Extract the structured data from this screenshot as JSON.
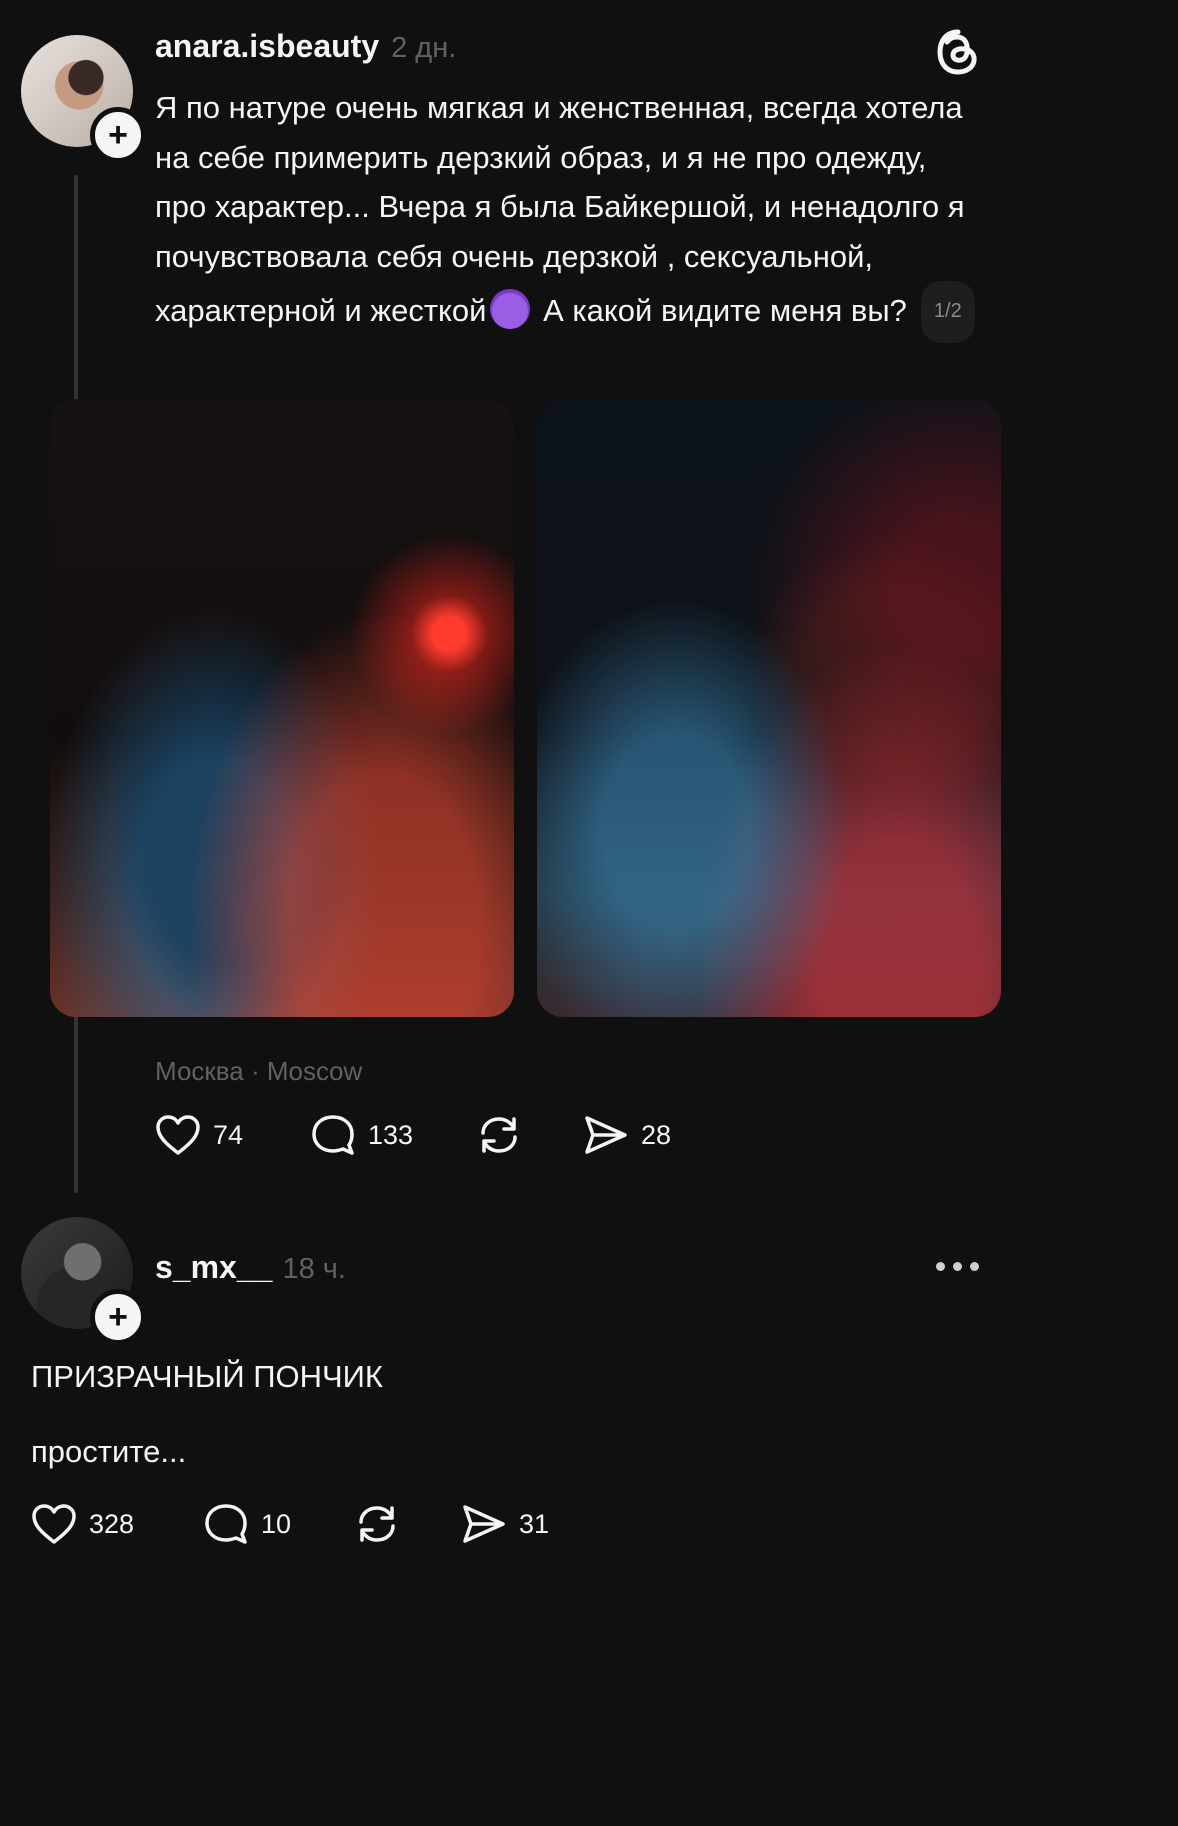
{
  "post": {
    "username": "anara.isbeauty",
    "time": "2 дн.",
    "text_before_emoji": "Я по натуре очень мягкая и женственная, всегда хотела на себе примерить дерзкий образ, и я не про одежду, про характер... Вчера я была Байкершой, и ненадолго я почувствовала себя очень дерзкой , сексуальной, характерной и жесткой",
    "text_after_emoji": " А какой видите меня вы?",
    "emoji": "smiling-devil-emoji",
    "page_indicator": "1/2",
    "location": "Москва · Moscow",
    "actions": {
      "likes": "74",
      "comments": "133",
      "shares": "28"
    }
  },
  "reply": {
    "username": "s_mx__",
    "time": "18 ч.",
    "line1": "ПРИЗРАЧНЫЙ ПОНЧИК",
    "line2": "простите...",
    "actions": {
      "likes": "328",
      "comments": "10",
      "shares": "31"
    }
  },
  "icons": {
    "app_logo": "threads-logo-icon",
    "follow": "plus-icon",
    "like": "heart-icon",
    "comment": "comment-bubble-icon",
    "repost": "repost-icon",
    "share": "send-icon",
    "more": "more-dots-icon"
  },
  "colors": {
    "background": "#101010",
    "text": "#f3f5f7",
    "muted": "#616161"
  }
}
